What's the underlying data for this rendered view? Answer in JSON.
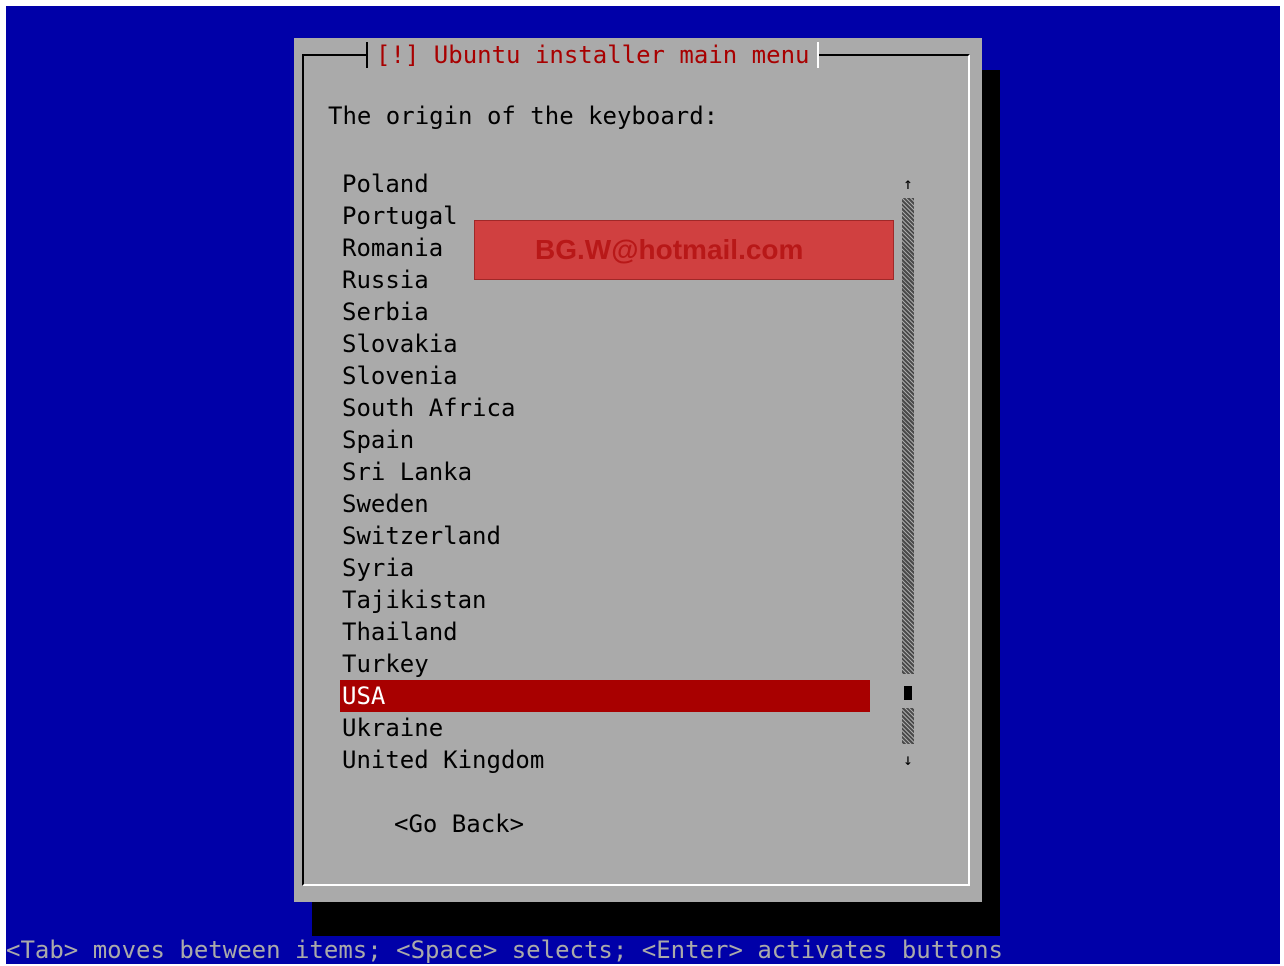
{
  "window": {
    "title": "[!] Ubuntu installer main menu"
  },
  "dialog": {
    "prompt": "The origin of the keyboard:",
    "items": [
      "Poland",
      "Portugal",
      "Romania",
      "Russia",
      "Serbia",
      "Slovakia",
      "Slovenia",
      "South Africa",
      "Spain",
      "Sri Lanka",
      "Sweden",
      "Switzerland",
      "Syria",
      "Tajikistan",
      "Thailand",
      "Turkey",
      "USA",
      "Ukraine",
      "United Kingdom"
    ],
    "selected_item": "USA",
    "scroll_up_arrow": "↑",
    "scroll_down_arrow": "↓",
    "go_back_label": "<Go Back>"
  },
  "overlay": {
    "watermark_text": "BG.W@hotmail.com"
  },
  "footer": {
    "help_text": "<Tab> moves between items; <Space> selects; <Enter> activates buttons"
  },
  "colors": {
    "screen_background": "#0000a8",
    "dialog_background": "#aaaaaa",
    "title_text": "#a80000",
    "selection_background": "#a80000",
    "selection_text": "#ffffff",
    "help_text": "#aaaaaa"
  }
}
